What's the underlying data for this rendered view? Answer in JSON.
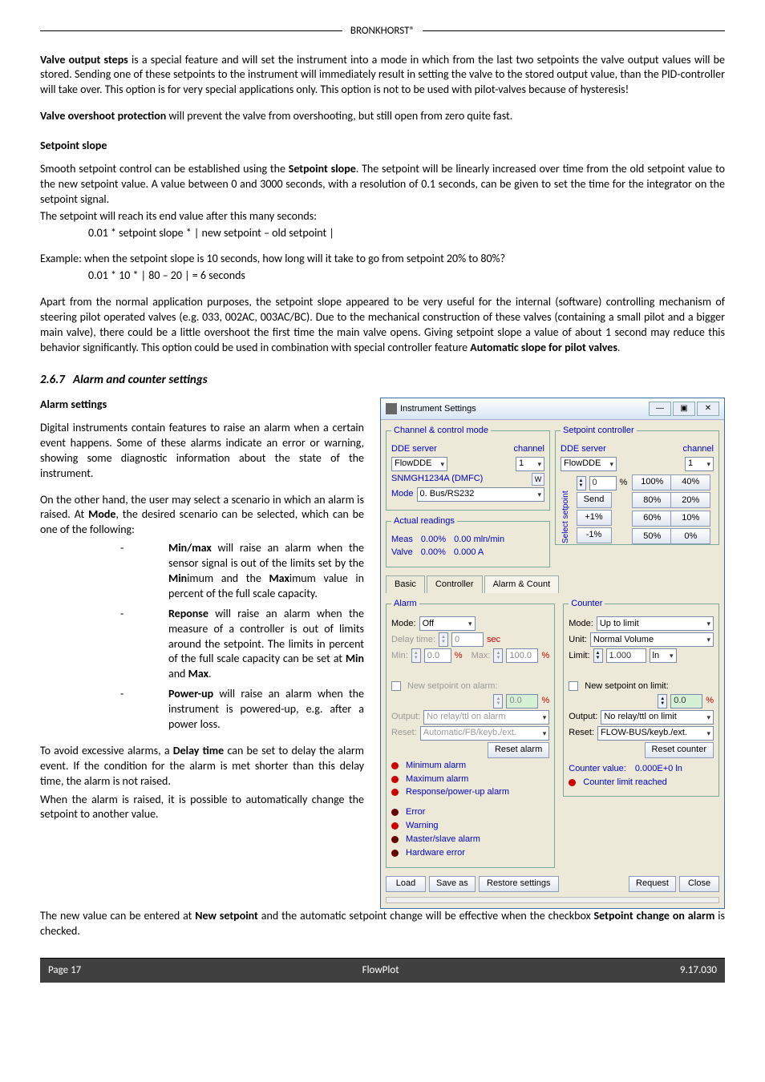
{
  "header": {
    "brand": "BRONKHORST®"
  },
  "body": {
    "p1_lead": "Valve output steps",
    "p1": " is a special feature and will set the instrument into a mode in which from the last two setpoints the valve output values will be stored. Sending one of these setpoints to the instrument will immediately result in setting the valve to the stored output value, than the PID-controller will take over. This option is for very special applications only. This option is not to be used with pilot-valves because of hysteresis!",
    "p2_lead": "Valve overshoot protection",
    "p2": " will prevent the valve from overshooting, but still open from zero quite fast.",
    "h_slope": "Setpoint slope",
    "p3a": "Smooth setpoint control can be established using the ",
    "p3b": "Setpoint slope",
    "p3c": ". The setpoint will be linearly increased over time from the old setpoint value to the new setpoint value. A value between 0 and 3000 seconds, with a resolution of 0.1 seconds, can be given to set the time for the integrator on the setpoint signal.",
    "p4": "The setpoint will reach its end value after this many seconds:",
    "formula": "0.01  * setpoint slope *  |  new setpoint – old setpoint  |",
    "p5": "Example: when the setpoint slope is 10 seconds, how long will it take to go from setpoint 20% to 80%?",
    "formula2": "0.01 * 10 *  | 80 – 20 |  = 6 seconds",
    "p6a": "Apart from the normal application purposes, the setpoint slope appeared to be very useful for the internal (software) controlling mechanism of steering pilot operated valves (e.g. 033, 002AC, 003AC/BC). Due to the mechanical construction of these valves (containing a small pilot and a bigger main valve), there could be a little overshoot the first time the main valve opens. Giving setpoint slope a value of about 1 second may reduce this behavior significantly. This option could be used in combination with special controller feature ",
    "p6b": "Automatic slope for pilot valves",
    "p6c": ".",
    "sec_num": "2.6.7",
    "sec_title": "Alarm and counter settings",
    "h_alarm": "Alarm settings",
    "p7a": "Digital instruments contain features to raise an alarm when a certain event happens. Some of these alarms indicate an error or warning, showing some diagnostic information about the state of the instrument.",
    "p7b_a": "On the other hand, the user may select a scenario in which an alarm is raised. At ",
    "p7b_b": "Mode",
    "p7b_c": ", the desired scenario can be selected, which can be one of the following:",
    "li1_a": "Min/max",
    "li1_b": " will raise an alarm when the sensor signal is out of the limits set by the ",
    "li1_c": "Min",
    "li1_d": "imum and the ",
    "li1_e": "Max",
    "li1_f": "imum value in percent of the full scale capacity.",
    "li2_a": "Reponse",
    "li2_b": " will raise an alarm when the measure of a controller is out of limits around the setpoint. The limits in percent of the full scale capacity can be set at ",
    "li2_c": "Min",
    "li2_d": " and ",
    "li2_e": "Max",
    "li2_f": ".",
    "li3_a": "Power-up",
    "li3_b": " will raise an alarm when the instrument is powered-up, e.g. after a power loss.",
    "p8_a": "To avoid excessive alarms, a ",
    "p8_b": "Delay time",
    "p8_c": " can be set to delay the alarm event. If the condition for the alarm is met shorter than this delay time, the alarm is not raised.",
    "p9": "When the alarm is raised, it is possible to automatically change the setpoint to another value.",
    "p10_a": "The new value can be entered at ",
    "p10_b": "New setpoint",
    "p10_c": " and the automatic setpoint change will be effective when the checkbox ",
    "p10_d": "Setpoint change on alarm",
    "p10_e": " is checked."
  },
  "dialog": {
    "title": "Instrument Settings",
    "channel_legend": "Channel & control mode",
    "dde_server_lbl": "DDE server",
    "channel_lbl": "channel",
    "flowdde": "FlowDDE",
    "channel_val": "1",
    "device": "SNMGH1234A (DMFC)",
    "w_btn": "W",
    "mode_lbl": "Mode",
    "mode_val": "0. Bus/RS232",
    "actual_legend": "Actual readings",
    "meas_lbl": "Meas",
    "meas_pct": "0.00%",
    "meas_unit": "0.00 mln/min",
    "valve_lbl": "Valve",
    "valve_pct": "0.00%",
    "valve_unit": "0.000 A",
    "sp_legend": "Setpoint controller",
    "sp_val": "0",
    "sp_pct": "%",
    "send": "Send",
    "select_sp": "Select setpoint",
    "b100": "100%",
    "b40": "40%",
    "b80": "80%",
    "b20": "20%",
    "bp1": "+1%",
    "b60": "60%",
    "b10": "10%",
    "bm1": "-1%",
    "b50": "50%",
    "b0": "0%",
    "tabs": {
      "basic": "Basic",
      "controller": "Controller",
      "alarm": "Alarm & Count"
    },
    "alarm_legend": "Alarm",
    "alarm_mode_lbl": "Mode:",
    "alarm_mode_val": "Off",
    "delay_lbl": "Delay time:",
    "delay_val": "0",
    "delay_unit": "sec",
    "min_lbl": "Min:",
    "min_val": "0.0",
    "pct_sign": "%",
    "max_lbl": "Max:",
    "max_val": "100.0",
    "new_sp_alarm": "New setpoint on alarm:",
    "nsp_alarm_val": "0.0",
    "output_lbl": "Output:",
    "output_val_a": "No relay/ttl on alarm",
    "reset_lbl": "Reset:",
    "reset_val_a": "Automatic/FB/keyb./ext.",
    "reset_alarm_btn": "Reset alarm",
    "ind_min": "Minimum alarm",
    "ind_max": "Maximum alarm",
    "ind_resp": "Response/power-up alarm",
    "ind_err": "Error",
    "ind_warn": "Warning",
    "ind_ms": "Master/slave alarm",
    "ind_hw": "Hardware error",
    "counter_legend": "Counter",
    "cnt_mode_lbl": "Mode:",
    "cnt_mode_val": "Up to limit",
    "unit_lbl": "Unit:",
    "unit_val": "Normal Volume",
    "limit_lbl": "Limit:",
    "limit_val": "1.000",
    "limit_unit": "ln",
    "new_sp_limit": "New setpoint on limit:",
    "nsp_limit_val": "0.0",
    "output_val_c": "No relay/ttl on limit",
    "reset_val_c": "FLOW-BUS/keyb./ext.",
    "reset_counter_btn": "Reset counter",
    "cnt_val_lbl": "Counter value:",
    "cnt_val": "0.000E+0 ln",
    "cnt_limit_reached": "Counter limit reached",
    "load": "Load",
    "saveas": "Save as",
    "restore": "Restore settings",
    "request": "Request",
    "close": "Close"
  },
  "footer": {
    "page": "Page 17",
    "product": "FlowPlot",
    "ver": "9.17.030"
  }
}
